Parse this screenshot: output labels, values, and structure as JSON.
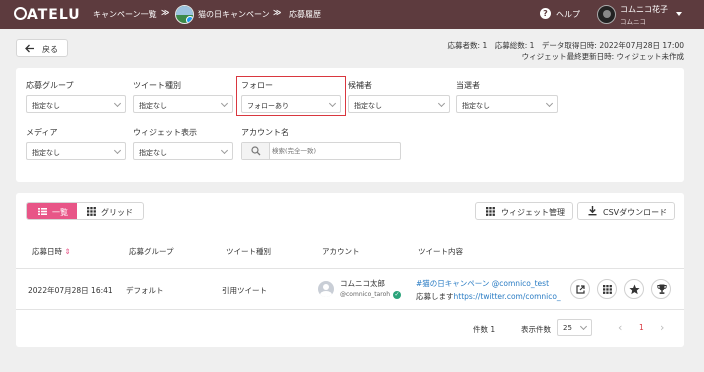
{
  "header": {
    "logo": "ATELU",
    "breadcrumb": [
      "キャンペーン一覧",
      "猫の日キャンペーン",
      "応募履歴"
    ],
    "separator": "≫",
    "help_label": "ヘルプ",
    "user_name": "コムニコ花子",
    "user_org": "コムニコ"
  },
  "toolbar": {
    "back_label": "戻る",
    "stats_line1": "応募者数: 1　応募総数: 1　データ取得日時: 2022年07月28日 17:00",
    "stats_line2": "ウィジェット最終更新日時: ウィジェット未作成"
  },
  "filters": [
    {
      "label": "応募グループ",
      "value": "指定なし"
    },
    {
      "label": "ツイート種別",
      "value": "指定なし"
    },
    {
      "label": "フォロー",
      "value": "フォローあり",
      "highlighted": true
    },
    {
      "label": "候補者",
      "value": "指定なし"
    },
    {
      "label": "当選者",
      "value": "指定なし"
    },
    {
      "label": "メディア",
      "value": "指定なし"
    },
    {
      "label": "ウィジェット表示",
      "value": "指定なし"
    },
    {
      "label": "アカウント名",
      "placeholder": "検索(完全一致)"
    }
  ],
  "view_toggle": {
    "list_label": "一覧",
    "grid_label": "グリッド",
    "active": "list"
  },
  "actions": {
    "widget_label": "ウィジェット管理",
    "csv_label": "CSVダウンロード"
  },
  "table": {
    "columns": [
      "応募日時",
      "応募グループ",
      "ツイート種別",
      "アカウント",
      "ツイート内容"
    ],
    "sort_indicator": "⇕",
    "rows": [
      {
        "date": "2022年07月28日 16:41",
        "group": "デフォルト",
        "type": "引用ツイート",
        "account_name": "コムニコ太郎",
        "account_id": "@comnico_taroh",
        "tweet_line1": "#猫の日キャンペーン @comnico_test",
        "tweet_line2_prefix": "応募します",
        "tweet_line2_link": "https://twitter.com/comnico_"
      }
    ]
  },
  "pagination": {
    "total_label": "件数 1",
    "per_page_label": "表示件数",
    "per_page_value": "25",
    "prev": "‹",
    "current_page": "1",
    "next": "›"
  },
  "colors": {
    "header_bg": "#5d3b3e",
    "accent": "#e85587",
    "highlight_border": "#d9373f",
    "link": "#2a7cc4"
  },
  "icons": [
    "back-arrow-icon",
    "help-icon",
    "chevron-down-icon",
    "search-icon",
    "list-icon",
    "grid-icon",
    "download-icon",
    "external-link-icon",
    "star-icon",
    "trophy-icon",
    "verified-icon"
  ]
}
